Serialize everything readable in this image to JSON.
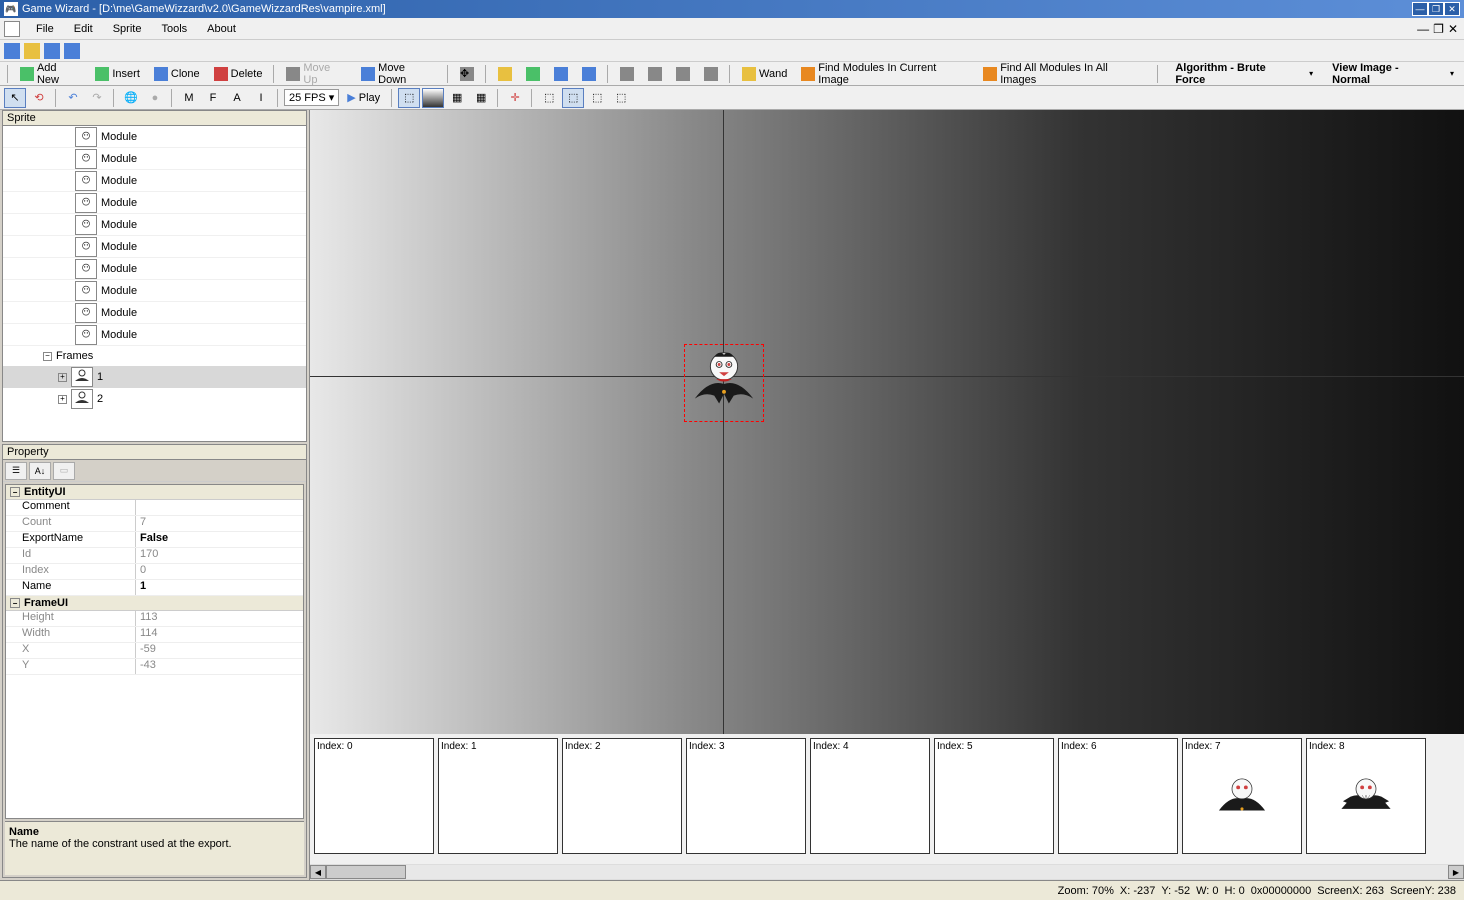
{
  "title": "Game Wizard - [D:\\me\\GameWizzard\\v2.0\\GameWizzardRes\\vampire.xml]",
  "menu": {
    "file": "File",
    "edit": "Edit",
    "sprite": "Sprite",
    "tools": "Tools",
    "about": "About"
  },
  "toolbar": {
    "addnew": "Add New",
    "insert": "Insert",
    "clone": "Clone",
    "delete": "Delete",
    "moveup": "Move Up",
    "movedown": "Move Down",
    "wand": "Wand",
    "findcur": "Find Modules In Current Image",
    "findall": "Find All Modules In All Images",
    "algo": "Algorithm - Brute Force",
    "view": "View Image - Normal"
  },
  "toolbar2": {
    "fps": "25 FPS",
    "play": "Play",
    "m": "M",
    "f": "F",
    "a": "A",
    "i": "I"
  },
  "panels": {
    "sprite": "Sprite",
    "property": "Property"
  },
  "tree": {
    "module": "Module",
    "frames": "Frames",
    "frame1": "1",
    "frame2": "2"
  },
  "props": {
    "entityui": "EntityUI",
    "comment": {
      "label": "Comment",
      "value": ""
    },
    "count": {
      "label": "Count",
      "value": "7"
    },
    "exportname": {
      "label": "ExportName",
      "value": "False"
    },
    "id": {
      "label": "Id",
      "value": "170"
    },
    "index": {
      "label": "Index",
      "value": "0"
    },
    "name": {
      "label": "Name",
      "value": "1"
    },
    "frameui": "FrameUI",
    "height": {
      "label": "Height",
      "value": "113"
    },
    "width": {
      "label": "Width",
      "value": "114"
    },
    "x": {
      "label": "X",
      "value": "-59"
    },
    "y": {
      "label": "Y",
      "value": "-43"
    }
  },
  "help": {
    "title": "Name",
    "text": "The name of the constrant used at the export."
  },
  "thumbs": [
    "Index: 0",
    "Index: 1",
    "Index: 2",
    "Index: 3",
    "Index: 4",
    "Index: 5",
    "Index: 6",
    "Index: 7",
    "Index: 8"
  ],
  "status": {
    "zoom": "Zoom: 70%",
    "x": "X: -237",
    "y": "Y: -52",
    "w": "W: 0",
    "h": "H: 0",
    "color": "0x00000000",
    "sx": "ScreenX: 263",
    "sy": "ScreenY: 238"
  }
}
